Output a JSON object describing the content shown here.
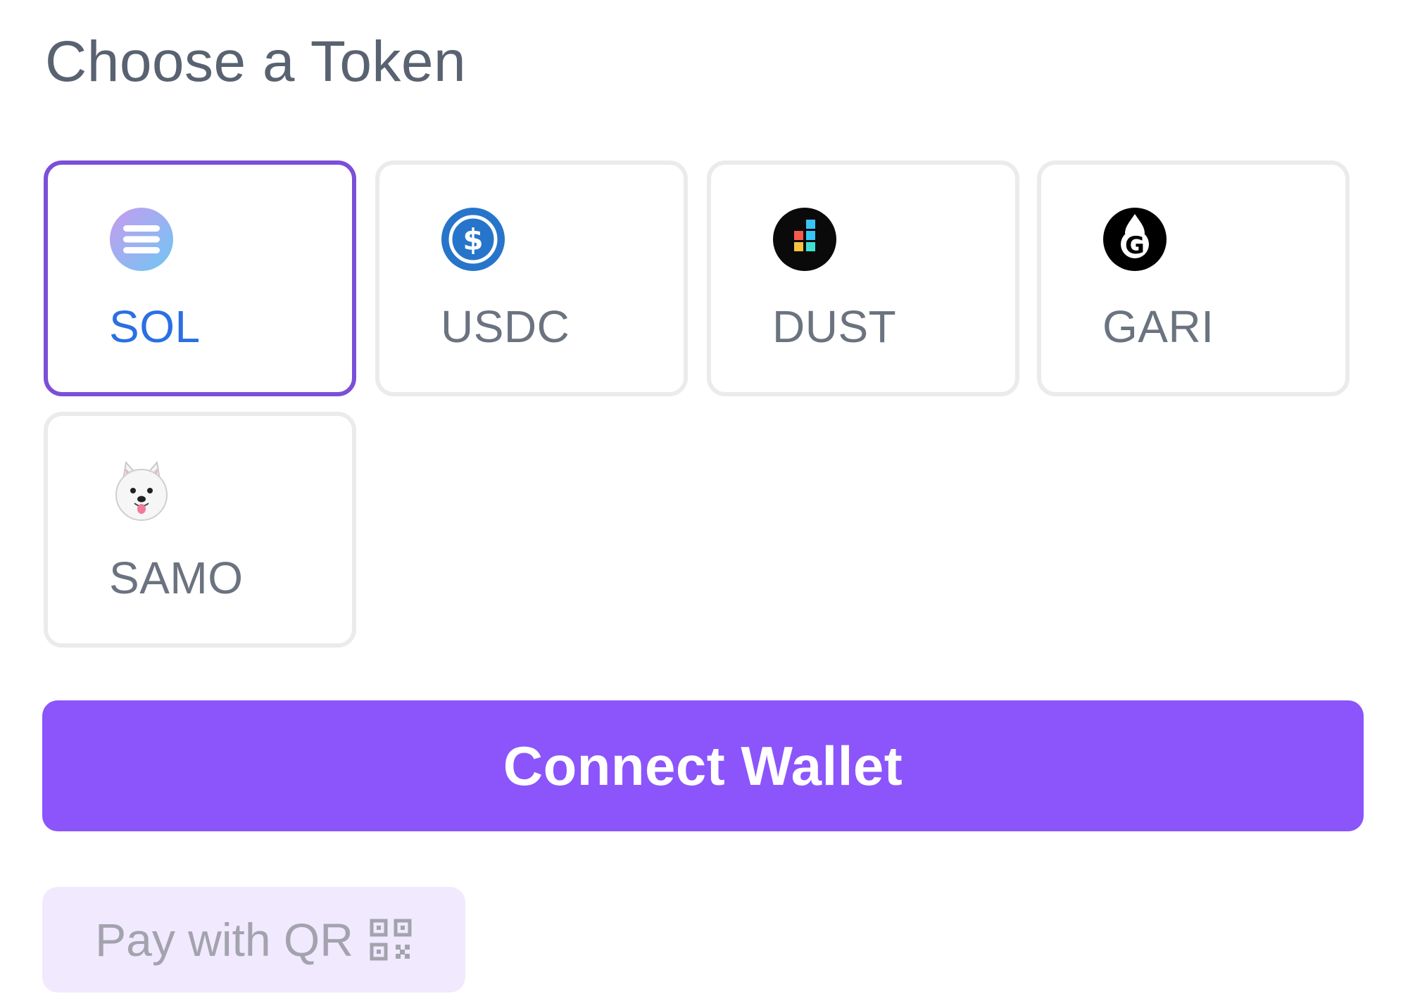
{
  "page": {
    "title": "Choose a Token"
  },
  "tokens": [
    {
      "label": "SOL",
      "icon": "sol-icon",
      "selected": true
    },
    {
      "label": "USDC",
      "icon": "usdc-icon",
      "selected": false
    },
    {
      "label": "DUST",
      "icon": "dust-icon",
      "selected": false
    },
    {
      "label": "GARI",
      "icon": "gari-icon",
      "selected": false
    },
    {
      "label": "SAMO",
      "icon": "samo-icon",
      "selected": false
    }
  ],
  "actions": {
    "connect_label": "Connect Wallet",
    "qr_label": "Pay with QR",
    "qr_icon": "qr-code-icon"
  },
  "colors": {
    "accent": "#8b55fb",
    "selected_border": "#7b4fd8",
    "selected_text": "#2a6fe4",
    "qr_button_bg": "#f1e9fe"
  }
}
